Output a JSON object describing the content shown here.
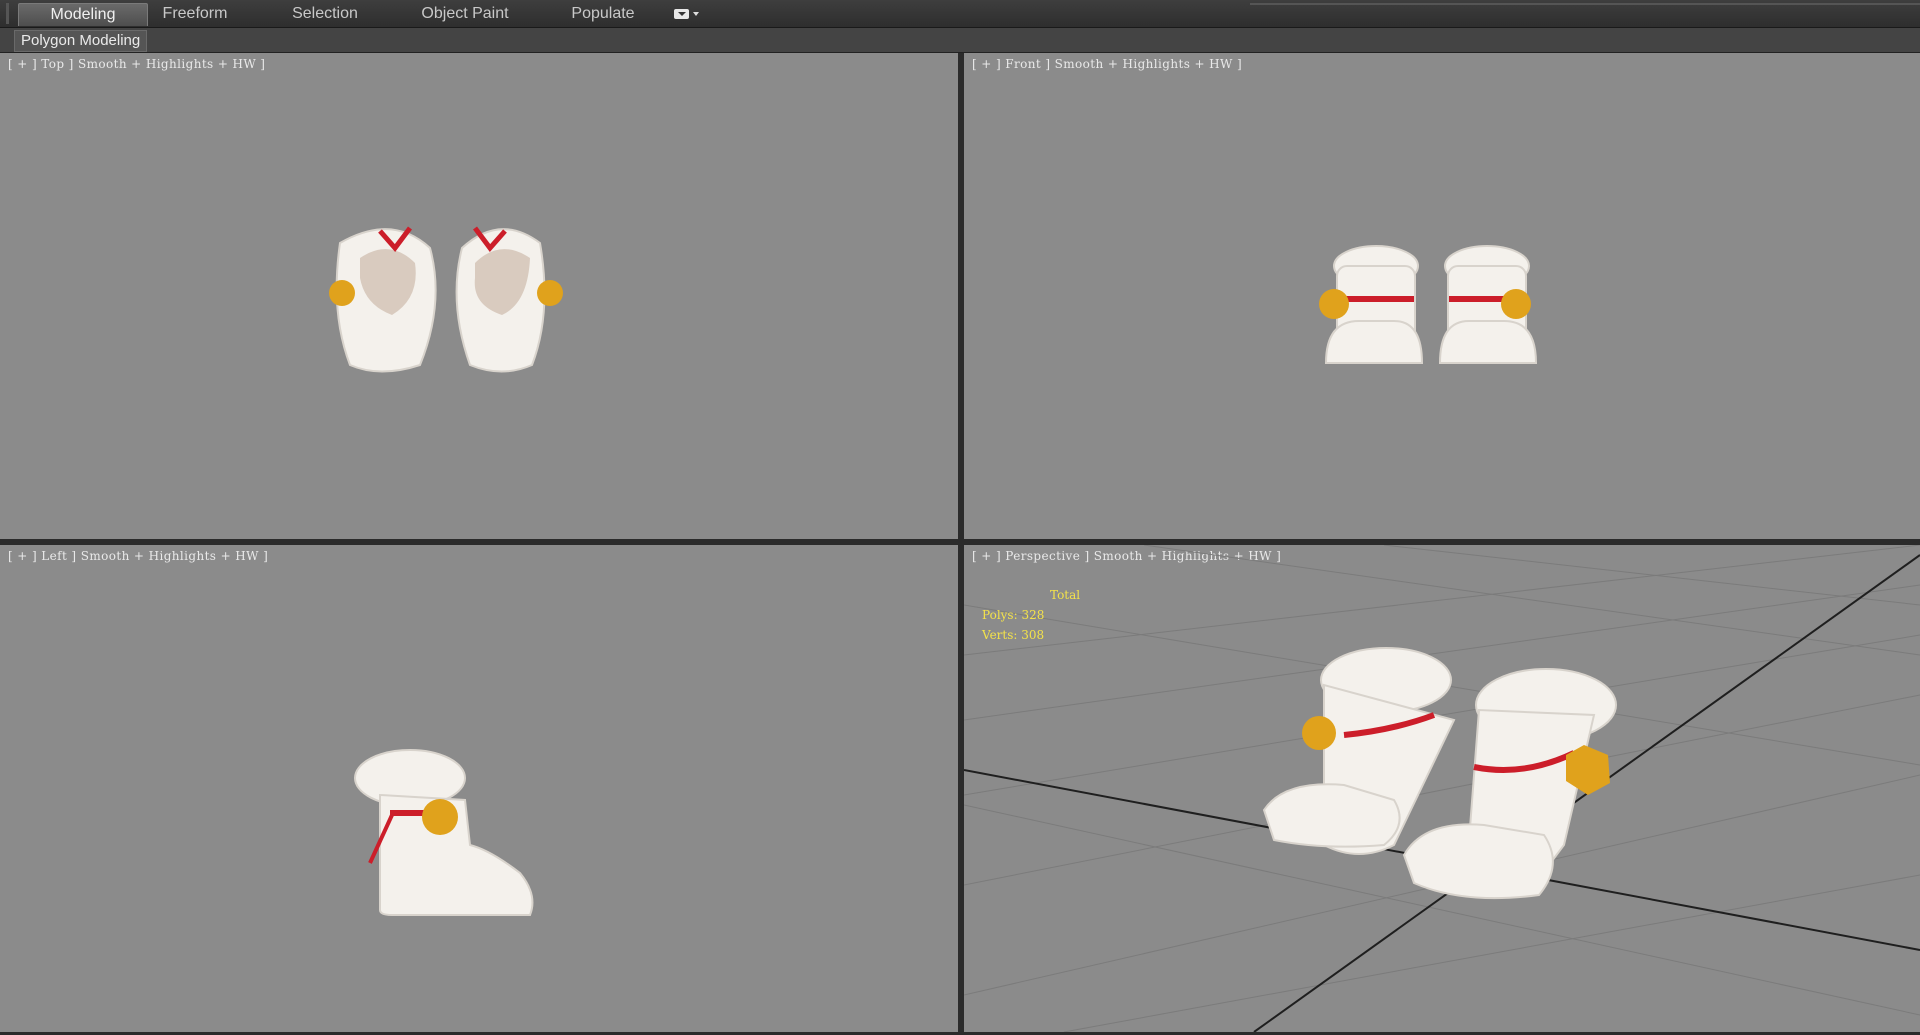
{
  "ribbon": {
    "tabs": [
      "Modeling",
      "Freeform",
      "Selection",
      "Object Paint",
      "Populate"
    ],
    "active_tab": "Modeling",
    "dropdown_icon": "ribbon-display-dropdown-icon"
  },
  "subbar": {
    "panel_label": "Polygon Modeling"
  },
  "viewports": {
    "top": {
      "label": "[ + ] Top ] Smooth + Highlights + HW ]"
    },
    "front": {
      "label": "[ + ] Front ] Smooth + Highlights + HW ]"
    },
    "left": {
      "label": "[ + ] Left ] Smooth + Highlights + HW ]"
    },
    "perspective": {
      "label": "[ + ] Perspective ] Smooth + Highlights + HW ]",
      "stats": {
        "title": "Total",
        "polys": "Polys: 328",
        "verts": "Verts: 308"
      }
    }
  },
  "colors": {
    "viewport_bg": "#8b8b8b",
    "stats_text": "#f3e24a",
    "fur": "#f4f1ec",
    "ribbon_red": "#cc1e2a",
    "bell_gold": "#e0a21c"
  }
}
